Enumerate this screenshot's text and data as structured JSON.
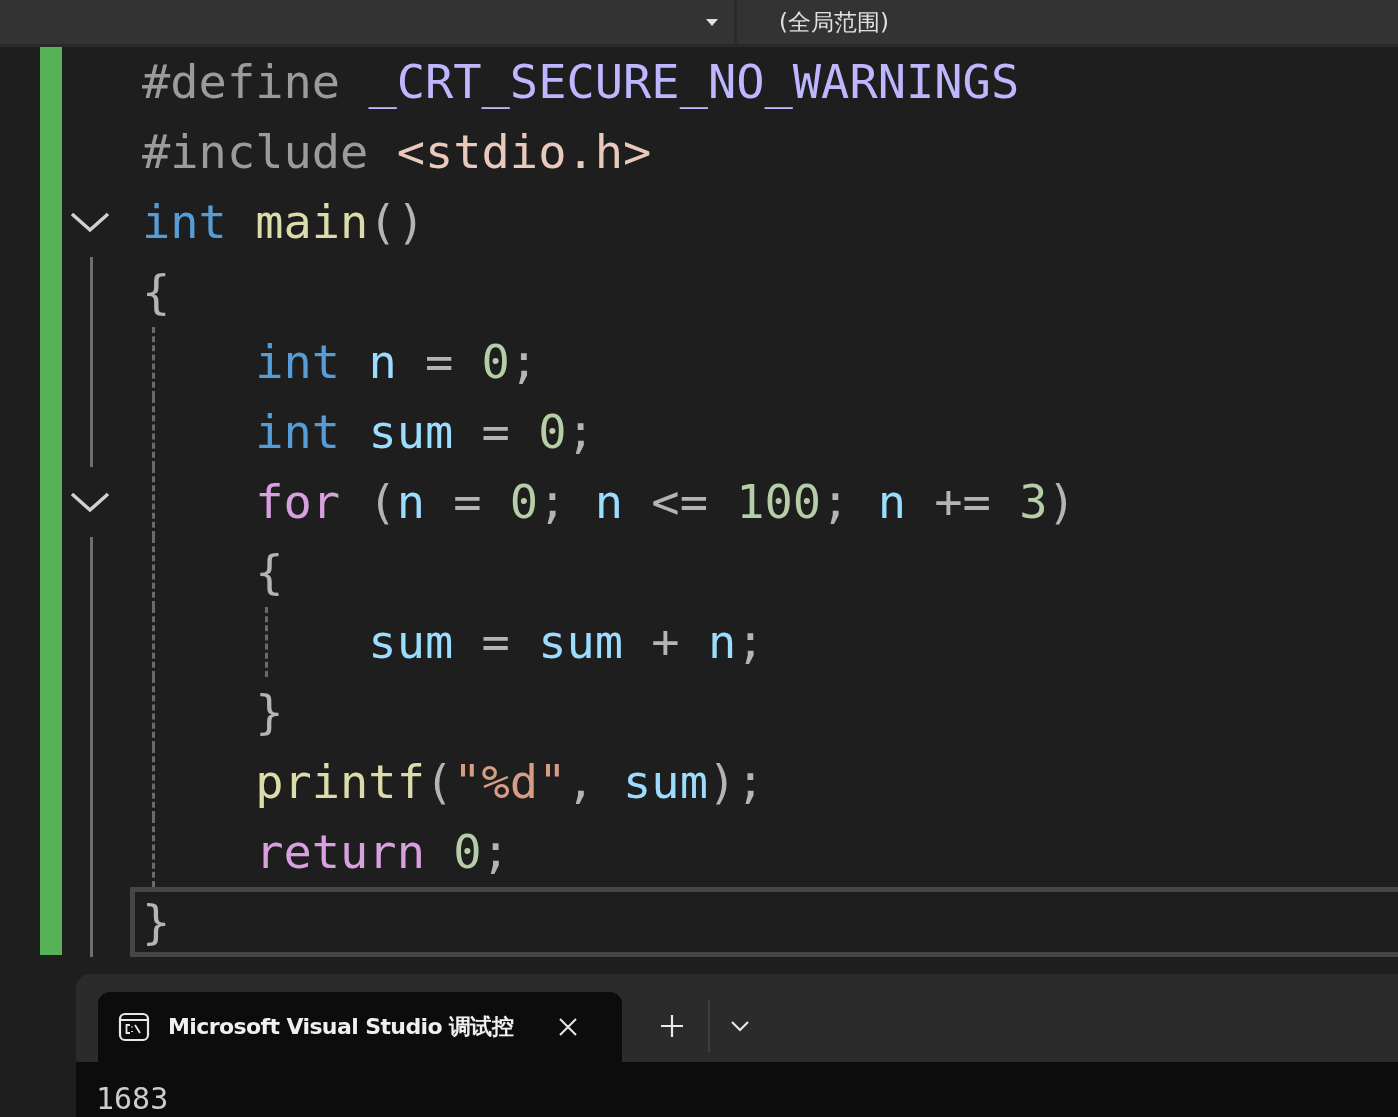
{
  "navigation_bar": {
    "scope": "(全局范围)"
  },
  "editor": {
    "lines": [
      {
        "fold": false,
        "current": false,
        "tokens": [
          {
            "text": "#define ",
            "kind": "preprocessor"
          },
          {
            "text": "_CRT_SECURE_NO_WARNINGS",
            "kind": "macro"
          }
        ]
      },
      {
        "fold": false,
        "current": false,
        "tokens": [
          {
            "text": "#include ",
            "kind": "preprocessor"
          },
          {
            "text": "<stdio.h>",
            "kind": "header"
          }
        ]
      },
      {
        "fold": true,
        "current": false,
        "tokens": [
          {
            "text": "int ",
            "kind": "keyword"
          },
          {
            "text": "main",
            "kind": "function"
          },
          {
            "text": "()",
            "kind": "punct"
          }
        ]
      },
      {
        "fold": false,
        "current": false,
        "tokens": [
          {
            "text": "{",
            "kind": "punct"
          }
        ]
      },
      {
        "fold": false,
        "current": false,
        "tokens": [
          {
            "text": "    int ",
            "kind": "keyword"
          },
          {
            "text": "n",
            "kind": "variable"
          },
          {
            "text": " = ",
            "kind": "punct"
          },
          {
            "text": "0",
            "kind": "number"
          },
          {
            "text": ";",
            "kind": "punct"
          }
        ]
      },
      {
        "fold": false,
        "current": false,
        "tokens": [
          {
            "text": "    int ",
            "kind": "keyword"
          },
          {
            "text": "sum",
            "kind": "variable"
          },
          {
            "text": " = ",
            "kind": "punct"
          },
          {
            "text": "0",
            "kind": "number"
          },
          {
            "text": ";",
            "kind": "punct"
          }
        ]
      },
      {
        "fold": true,
        "current": false,
        "tokens": [
          {
            "text": "    for",
            "kind": "control"
          },
          {
            "text": " (",
            "kind": "punct"
          },
          {
            "text": "n",
            "kind": "variable"
          },
          {
            "text": " = ",
            "kind": "punct"
          },
          {
            "text": "0",
            "kind": "number"
          },
          {
            "text": "; ",
            "kind": "punct"
          },
          {
            "text": "n",
            "kind": "variable"
          },
          {
            "text": " <= ",
            "kind": "punct"
          },
          {
            "text": "100",
            "kind": "number"
          },
          {
            "text": "; ",
            "kind": "punct"
          },
          {
            "text": "n",
            "kind": "variable"
          },
          {
            "text": " += ",
            "kind": "punct"
          },
          {
            "text": "3",
            "kind": "number"
          },
          {
            "text": ")",
            "kind": "punct"
          }
        ]
      },
      {
        "fold": false,
        "current": false,
        "tokens": [
          {
            "text": "    {",
            "kind": "punct"
          }
        ]
      },
      {
        "fold": false,
        "current": false,
        "tokens": [
          {
            "text": "        sum",
            "kind": "variable"
          },
          {
            "text": " = ",
            "kind": "punct"
          },
          {
            "text": "sum",
            "kind": "variable"
          },
          {
            "text": " + ",
            "kind": "punct"
          },
          {
            "text": "n",
            "kind": "variable"
          },
          {
            "text": ";",
            "kind": "punct"
          }
        ]
      },
      {
        "fold": false,
        "current": false,
        "tokens": [
          {
            "text": "    }",
            "kind": "punct"
          }
        ]
      },
      {
        "fold": false,
        "current": false,
        "tokens": [
          {
            "text": "    printf",
            "kind": "function"
          },
          {
            "text": "(",
            "kind": "punct"
          },
          {
            "text": "\"%d\"",
            "kind": "string"
          },
          {
            "text": ", ",
            "kind": "punct"
          },
          {
            "text": "sum",
            "kind": "variable"
          },
          {
            "text": ");",
            "kind": "punct"
          }
        ]
      },
      {
        "fold": false,
        "current": false,
        "tokens": [
          {
            "text": "    return ",
            "kind": "control"
          },
          {
            "text": "0",
            "kind": "number"
          },
          {
            "text": ";",
            "kind": "punct"
          }
        ]
      },
      {
        "fold": false,
        "current": true,
        "tokens": [
          {
            "text": "}",
            "kind": "punct"
          }
        ]
      }
    ]
  },
  "terminal": {
    "tab": {
      "title": "Microsoft Visual Studio 调试控",
      "selected": true
    },
    "output": "1683"
  }
}
